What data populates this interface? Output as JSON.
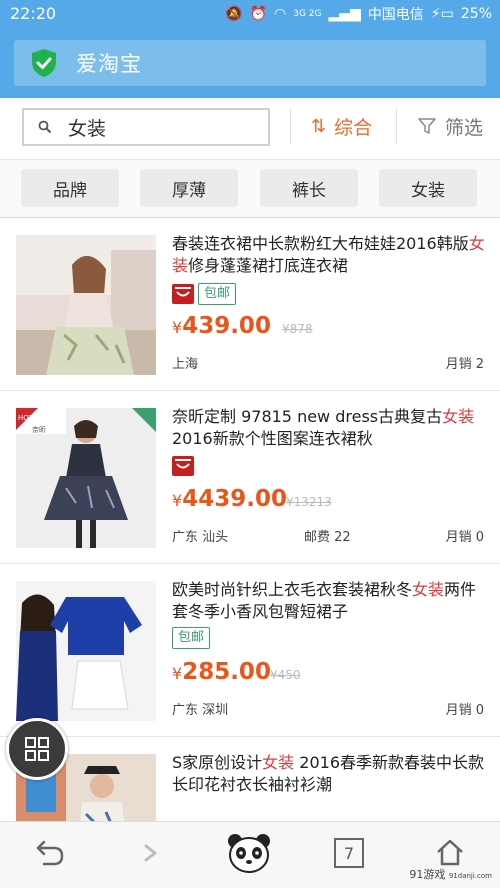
{
  "status_bar": {
    "time": "22:20",
    "signal_text": "3G 2G",
    "carrier": "中国电信",
    "battery": "25%"
  },
  "header": {
    "title": "爱淘宝"
  },
  "search": {
    "query": "女装"
  },
  "sort": {
    "label": "综合"
  },
  "filter": {
    "label": "筛选"
  },
  "chips": [
    "品牌",
    "厚薄",
    "裤长",
    "女装"
  ],
  "products": [
    {
      "title_pre": "春装连衣裙中长款粉红大布娃娃2016韩版",
      "title_hl": "女装",
      "title_post": "修身蓬蓬裙打底连衣裙",
      "tmall": true,
      "baoyou": "包邮",
      "price": "439.00",
      "original_price": "¥878",
      "location": "上海",
      "postage": "",
      "sales": "月销 2"
    },
    {
      "title_pre": "奈昕定制 97815 new dress古典复古",
      "title_hl": "女装",
      "title_post": "2016新款个性图案连衣裙秋",
      "tmall": true,
      "baoyou": "",
      "price": "4439.00",
      "original_price": "¥13213",
      "location": "广东 汕头",
      "postage": "邮费 22",
      "sales": "月销 0"
    },
    {
      "title_pre": "欧美时尚针织上衣毛衣套装裙秋冬",
      "title_hl": "女装",
      "title_post": "两件套冬季小香风包臀短裙子",
      "tmall": false,
      "baoyou": "包邮",
      "price": "285.00",
      "original_price": "¥450",
      "location": "广东 深圳",
      "postage": "",
      "sales": "月销 0"
    },
    {
      "title_pre": "S家原创设计",
      "title_hl": "女装",
      "title_post": " 2016春季新款春装中长款长印花衬衣长袖衬衫潮",
      "tmall": false,
      "baoyou": "",
      "price": "",
      "original_price": "",
      "location": "",
      "postage": "",
      "sales": ""
    }
  ],
  "currency": "¥",
  "watermark": "91游戏",
  "watermark_url": "91danji.com",
  "colors": {
    "header_blue": "#56a9e8",
    "price_orange": "#e8561b",
    "highlight_red": "#e23a3a",
    "tmall_red": "#c61f1f",
    "green": "#3aa06d"
  },
  "icons": {
    "shield": "shield-check-icon",
    "search": "search-icon",
    "sort": "sort-arrows-icon",
    "filter": "funnel-icon",
    "fab": "grid-icon",
    "back": "back-arrow-icon",
    "forward": "forward-arrow-icon",
    "panda": "panda-icon",
    "tabs": "tabs-count-icon",
    "home": "home-icon"
  },
  "tab_count": "7"
}
